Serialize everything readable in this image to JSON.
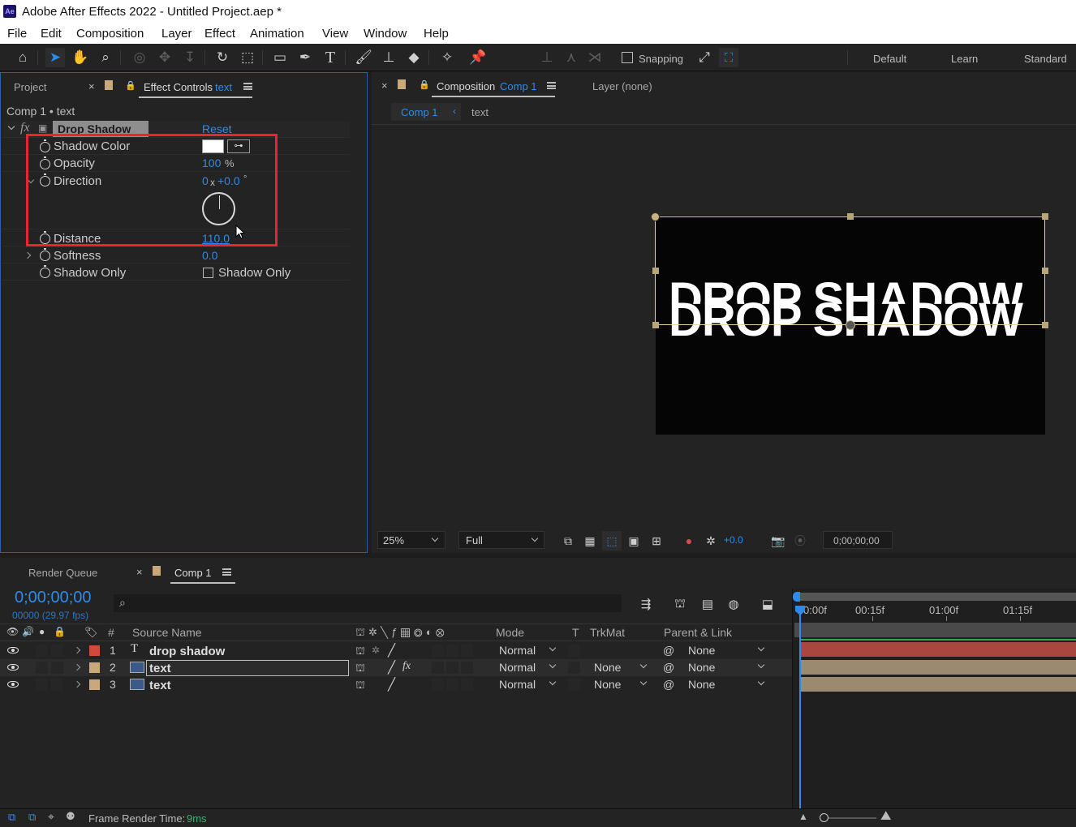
{
  "window": {
    "app_badge": "Ae",
    "title": "Adobe After Effects 2022 - Untitled Project.aep *"
  },
  "menu": [
    "File",
    "Edit",
    "Composition",
    "Layer",
    "Effect",
    "Animation",
    "View",
    "Window",
    "Help"
  ],
  "toolbar": {
    "snapping_label": "Snapping",
    "workspaces": [
      "Default",
      "Learn",
      "Standard"
    ]
  },
  "left_panel": {
    "tabs": {
      "project": "Project",
      "effect_controls": "Effect Controls",
      "effect_controls_layer": "text"
    },
    "breadcrumb": "Comp 1 • text",
    "effect": {
      "name": "Drop Shadow",
      "reset_label": "Reset",
      "properties": {
        "shadow_color": {
          "label": "Shadow Color",
          "color": "#ffffff"
        },
        "opacity": {
          "label": "Opacity",
          "value": "100",
          "unit": "%"
        },
        "direction": {
          "label": "Direction",
          "rotations": "0",
          "x": "x",
          "angle": "+0.0",
          "unit": "°"
        },
        "distance": {
          "label": "Distance",
          "value": "110.0"
        },
        "softness": {
          "label": "Softness",
          "value": "0.0"
        },
        "shadow_only": {
          "label": "Shadow Only",
          "checkbox_label": "Shadow Only",
          "checked": false
        }
      }
    },
    "highlight_color": "#e8262d"
  },
  "comp_panel": {
    "tab_label": "Composition",
    "tab_comp": "Comp 1",
    "layer_tab": "Layer (none)",
    "breadcrumbs": [
      "Comp 1",
      "text"
    ],
    "canvas_text": "DROP SHADOW",
    "footer": {
      "zoom": "25%",
      "resolution": "Full",
      "exposure": "+0.0",
      "timecode": "0;00;00;00"
    }
  },
  "timeline": {
    "tabs": {
      "render_queue": "Render Queue",
      "comp": "Comp 1"
    },
    "timecode": "0;00;00;00",
    "frame_info": "00000 (29.97 fps)",
    "search_placeholder": "",
    "columns": {
      "num": "#",
      "source_name": "Source Name",
      "mode": "Mode",
      "t": "T",
      "trkmat": "TrkMat",
      "parent": "Parent & Link"
    },
    "ruler": [
      "0:00f",
      "00:15f",
      "01:00f",
      "01:15f"
    ],
    "layers": [
      {
        "num": "1",
        "name": "drop shadow",
        "type": "T",
        "label_color": "#d04a3a",
        "mode": "Normal",
        "trkmat": "",
        "parent": "None",
        "bar_color": "#a8473f"
      },
      {
        "num": "2",
        "name": "text",
        "type": "footage",
        "label_color": "#c9a97a",
        "mode": "Normal",
        "trkmat": "None",
        "parent": "None",
        "bar_color": "#9c8a70",
        "fx": "fx"
      },
      {
        "num": "3",
        "name": "text",
        "type": "footage",
        "label_color": "#c9a97a",
        "mode": "Normal",
        "trkmat": "None",
        "parent": "None",
        "bar_color": "#9c8a70"
      }
    ]
  },
  "status": {
    "label": "Frame Render Time:",
    "value": "9ms"
  }
}
